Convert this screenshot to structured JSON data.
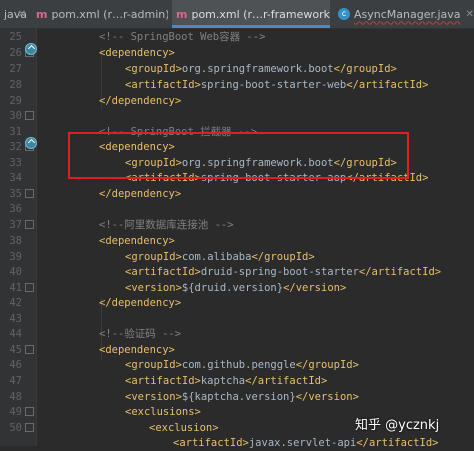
{
  "tabs": [
    {
      "label": "java",
      "active": false
    },
    {
      "label": "pom.xml (ruoyi-admin)",
      "active": false,
      "display": "pom.xml (r…r-admin)"
    },
    {
      "label": "pom.xml (ruoyi-framework)",
      "active": true,
      "display": "pom.xml (r…r-framework)"
    },
    {
      "label": "AsyncManager.java",
      "active": false
    }
  ],
  "line_numbers": [
    "25",
    "26",
    "27",
    "28",
    "29",
    "30",
    "31",
    "32",
    "33",
    "34",
    "35",
    "36",
    "37",
    "38",
    "39",
    "40",
    "41",
    "42",
    "43",
    "44",
    "45",
    "46",
    "47",
    "48",
    "49",
    "50"
  ],
  "code": {
    "l25": "<!-- SpringBoot Web容器 -->",
    "l26_open": "<dependency>",
    "l27_group": "org.springframework.boot",
    "l28_artifact": "spring-boot-starter-web",
    "l29_close": "</dependency>",
    "l31": "<!-- SpringBoot 拦截器 -->",
    "l32_open": "<dependency>",
    "l33_group": "org.springframework.boot",
    "l34_artifact": "spring-boot-starter-aop",
    "l35_close": "</dependency>",
    "l37": "<!--阿里数据库连接池 -->",
    "l38_open": "<dependency>",
    "l39_group": "com.alibaba",
    "l40_artifact": "druid-spring-boot-starter",
    "l41_version": "${druid.version}",
    "l42_close": "</dependency>",
    "l44": "<!--验证码 -->",
    "l45_open": "<dependency>",
    "l46_group": "com.github.penggle",
    "l47_artifact": "kaptcha",
    "l48_version": "${kaptcha.version}",
    "l49_open": "<exclusions>",
    "l50_open": "<exclusion>",
    "l51_artifact": "javax.servlet-api"
  },
  "watermark": "知乎 @ycznkj",
  "colors": {
    "background": "#2b2b2b",
    "tag": "#e8bf6a",
    "comment": "#808080",
    "text": "#a9b7c6",
    "highlight_border": "#e02020",
    "active_tab_underline": "#4a88c7"
  }
}
